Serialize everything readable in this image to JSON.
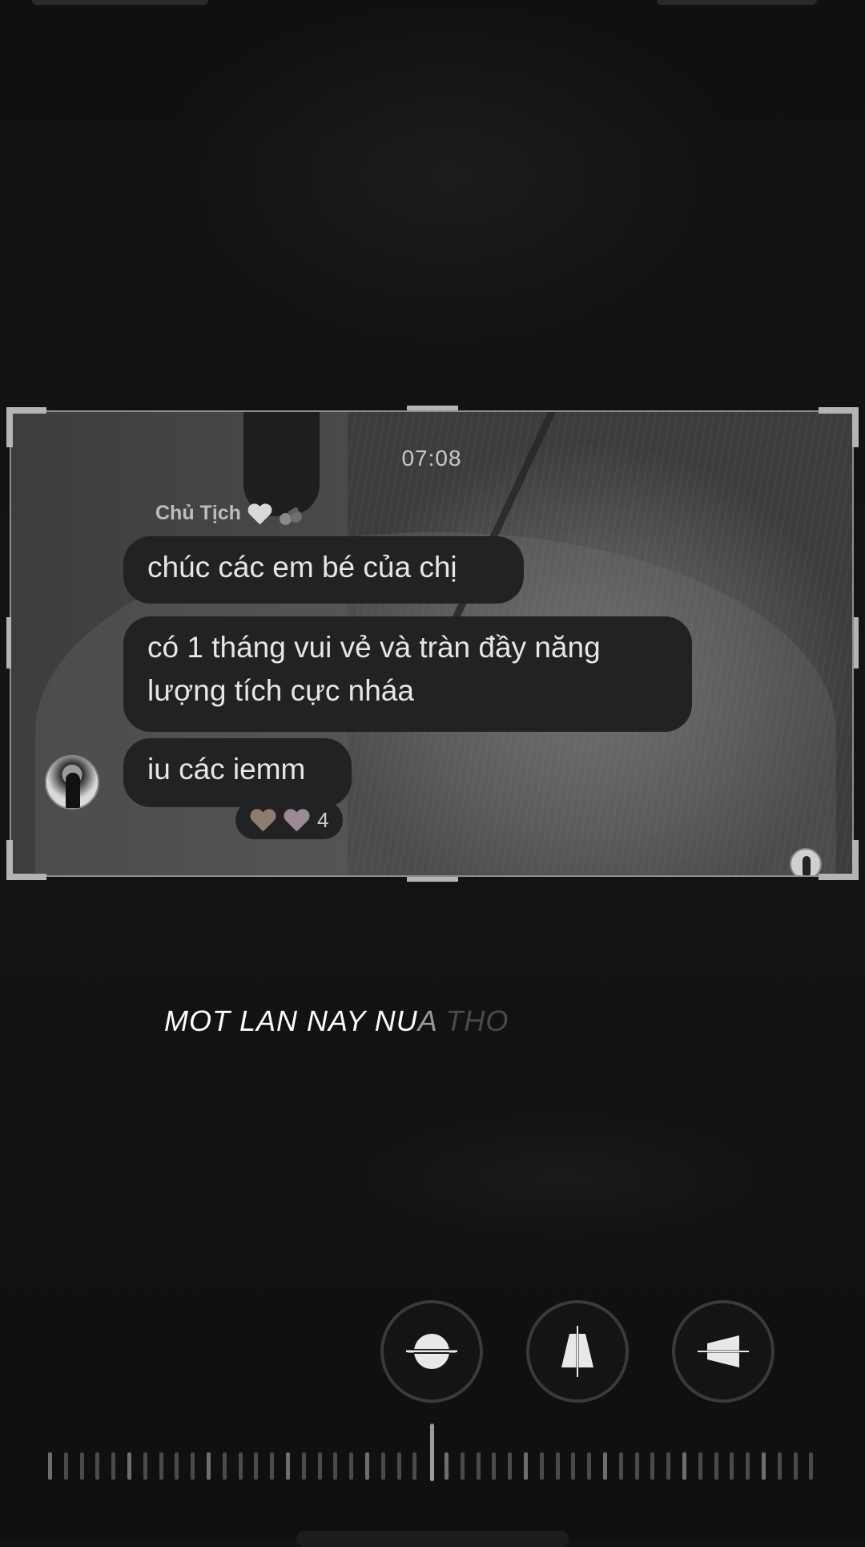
{
  "chat": {
    "time": "07:08",
    "sender": "Chủ Tịch",
    "sender_emojis": [
      "white-heart-icon",
      "cherry-icon"
    ],
    "messages": [
      "chúc các em bé của chị",
      "có 1 tháng vui vẻ và tràn đầy năng lượng tích cực nháa",
      "iu các iemm"
    ],
    "reactions": {
      "icons": [
        "brown-heart-icon",
        "pink-heart-icon"
      ],
      "count": "4"
    }
  },
  "lyrics": {
    "bright": "MOT LAN NAY NU",
    "mid": "A",
    "dim": "THO"
  },
  "controls": [
    {
      "name": "straighten-button",
      "icon": "straighten-icon"
    },
    {
      "name": "vertical-perspective-button",
      "icon": "vertical-perspective-icon"
    },
    {
      "name": "horizontal-perspective-button",
      "icon": "horizontal-perspective-icon"
    }
  ],
  "colors": {
    "background": "#121213",
    "bubble": "#222224",
    "frame": "#b4b4b6",
    "text": "#e6e6e6"
  }
}
